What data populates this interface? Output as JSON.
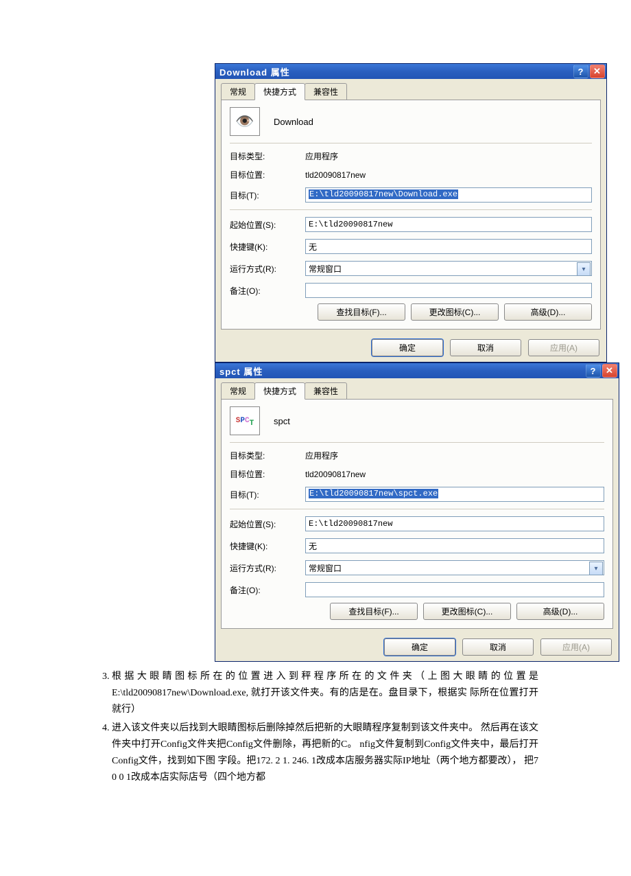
{
  "dialog1": {
    "title": "Download 属性",
    "tabs": {
      "general": "常规",
      "shortcut": "快捷方式",
      "compat": "兼容性"
    },
    "appname": "Download",
    "labels": {
      "targetType": "目标类型:",
      "targetLoc": "目标位置:",
      "target": "目标(T):",
      "startIn": "起始位置(S):",
      "hotkey": "快捷键(K):",
      "runMode": "运行方式(R):",
      "comment": "备注(O):"
    },
    "values": {
      "targetType": "应用程序",
      "targetLoc": "tld20090817new",
      "target": "E:\\tld20090817new\\Download.exe",
      "startIn": "E:\\tld20090817new",
      "hotkey": "无",
      "runMode": "常规窗口",
      "comment": ""
    },
    "buttons": {
      "findTarget": "查找目标(F)...",
      "changeIcon": "更改图标(C)...",
      "advanced": "高级(D)...",
      "ok": "确定",
      "cancel": "取消",
      "apply": "应用(A)"
    }
  },
  "dialog2": {
    "title": "spct 属性",
    "tabs": {
      "general": "常规",
      "shortcut": "快捷方式",
      "compat": "兼容性"
    },
    "appname": "spct",
    "labels": {
      "targetType": "目标类型:",
      "targetLoc": "目标位置:",
      "target": "目标(T):",
      "startIn": "起始位置(S):",
      "hotkey": "快捷键(K):",
      "runMode": "运行方式(R):",
      "comment": "备注(O):"
    },
    "values": {
      "targetType": "应用程序",
      "targetLoc": "tld20090817new",
      "target": "E:\\tld20090817new\\spct.exe",
      "startIn": "E:\\tld20090817new",
      "hotkey": "无",
      "runMode": "常规窗口",
      "comment": ""
    },
    "buttons": {
      "findTarget": "查找目标(F)...",
      "changeIcon": "更改图标(C)...",
      "advanced": "高级(D)...",
      "ok": "确定",
      "cancel": "取消",
      "apply": "应用(A)"
    }
  },
  "doc": {
    "item3": "根据大眼睛图标所在的位置进入到秤程序所在的文件夹（上图大眼睛的位置是E:\\tld20090817new\\Download.exe, 就打开该文件夹。有的店是在。盘目录下，根据实 际所在位置打开就行）",
    "item4": "进入该文件夹以后找到大眼睛图标后删除掉然后把新的大眼睛程序复制到该文件夹中。 然后再在该文件夹中打开Config文件夹把Config文件删除，再把新的C。 nfig文件复制到Config文件夹中，最后打开Config文件，找到如下图 字段。把172. 2 1. 246. 1改成本店服务器实际IP地址（两个地方都要改）， 把7 0 0 1改成本店实际店号（四个地方都"
  }
}
